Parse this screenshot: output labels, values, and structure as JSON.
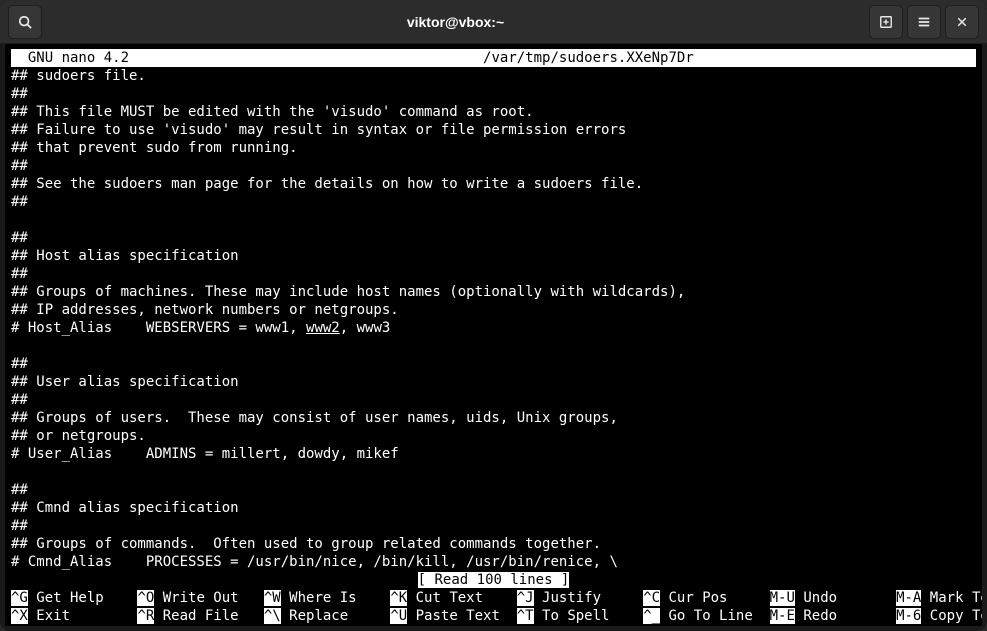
{
  "titlebar": {
    "title": "viktor@vbox:~"
  },
  "nano": {
    "app_label": "  GNU nano 4.2",
    "file_path": "/var/tmp/sudoers.XXeNp7Dr",
    "status": "[ Read 100 lines ]"
  },
  "content": {
    "l01": "## sudoers file.",
    "l02": "##",
    "l03": "## This file MUST be edited with the 'visudo' command as root.",
    "l04": "## Failure to use 'visudo' may result in syntax or file permission errors",
    "l05": "## that prevent sudo from running.",
    "l06": "##",
    "l07": "## See the sudoers man page for the details on how to write a sudoers file.",
    "l08": "##",
    "l09": "",
    "l10": "##",
    "l11": "## Host alias specification",
    "l12": "##",
    "l13": "## Groups of machines. These may include host names (optionally with wildcards),",
    "l14": "## IP addresses, network numbers or netgroups.",
    "l15a": "# Host_Alias    WEBSERVERS = www1, ",
    "l15u": "www2",
    "l15b": ", www3",
    "l16": "",
    "l17": "##",
    "l18": "## User alias specification",
    "l19": "##",
    "l20": "## Groups of users.  These may consist of user names, uids, Unix groups,",
    "l21": "## or netgroups.",
    "l22": "# User_Alias    ADMINS = millert, dowdy, mikef",
    "l23": "",
    "l24": "##",
    "l25": "## Cmnd alias specification",
    "l26": "##",
    "l27": "## Groups of commands.  Often used to group related commands together.",
    "l28": "# Cmnd_Alias    PROCESSES = /usr/bin/nice, /bin/kill, /usr/bin/renice, \\"
  },
  "shortcuts": {
    "r1": {
      "k1": "^G",
      "t1": " Get Help    ",
      "k2": "^O",
      "t2": " Write Out   ",
      "k3": "^W",
      "t3": " Where Is    ",
      "k4": "^K",
      "t4": " Cut Text    ",
      "k5": "^J",
      "t5": " Justify     ",
      "k6": "^C",
      "t6": " Cur Pos     ",
      "k7": "M-U",
      "t7": " Undo       ",
      "k8": "M-A",
      "t8": " Mark Text"
    },
    "r2": {
      "k1": "^X",
      "t1": " Exit        ",
      "k2": "^R",
      "t2": " Read File   ",
      "k3": "^\\",
      "t3": " Replace     ",
      "k4": "^U",
      "t4": " Paste Text  ",
      "k5": "^T",
      "t5": " To Spell    ",
      "k6": "^_",
      "t6": " Go To Line  ",
      "k7": "M-E",
      "t7": " Redo       ",
      "k8": "M-6",
      "t8": " Copy Text"
    }
  }
}
